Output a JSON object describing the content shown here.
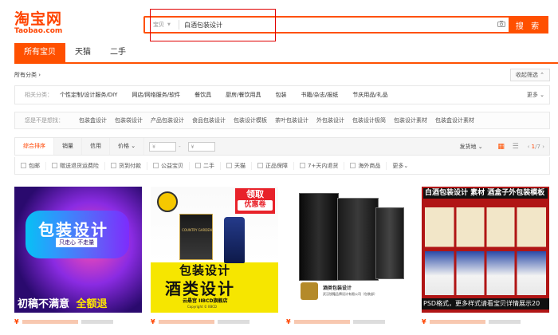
{
  "header": {
    "logo_cn": "淘宝网",
    "logo_en": "Taobao.com",
    "search_category": "宝贝",
    "search_value": "白酒包装设计",
    "search_button": "搜 索"
  },
  "tabs": [
    {
      "label": "所有宝贝",
      "active": true
    },
    {
      "label": "天猫",
      "active": false
    },
    {
      "label": "二手",
      "active": false
    }
  ],
  "crumb": {
    "all_categories": "所有分类",
    "fold": "收起筛选"
  },
  "related": {
    "label": "相关分类：",
    "items": [
      "个性定制/设计服务/DIY",
      "网店/网络服务/软件",
      "餐饮具",
      "厨房/餐饮用具",
      "包装",
      "书籍/杂志/报纸",
      "节庆用品/礼品"
    ],
    "more": "更多"
  },
  "want": {
    "label": "您是不是想找：",
    "items": [
      "包装盒设计",
      "包装袋设计",
      "产品包装设计",
      "食品包装设计",
      "包装设计模板",
      "茶叶包装设计",
      "外包装设计",
      "包装设计极简",
      "包装设计素材",
      "包装盒设计素材"
    ]
  },
  "sort": {
    "items": [
      "综合排序",
      "销量",
      "信用",
      "价格"
    ],
    "price_symbol": "¥",
    "ship_from": "发货地",
    "page_current": "1",
    "page_total": "/7"
  },
  "checks": {
    "items": [
      "包邮",
      "赠送退货运费险",
      "货到付款",
      "公益宝贝",
      "二手",
      "天猫",
      "正品保障",
      "7+天内退货",
      "海外商品"
    ],
    "more": "更多"
  },
  "products": [
    {
      "line1": "包装设计",
      "line2": "只走心 不走量",
      "line3": "初稿不满意",
      "line4": "全额退",
      "price": "¥"
    },
    {
      "badge1": "领取",
      "badge2": "优惠卷",
      "brand": "COUNTRY GARDEN",
      "line1": "包装设计",
      "line2": "酒类设计",
      "shop": "云悬宫 IIBCD旗舰店",
      "copyright": "Copyright © IIBCD",
      "price": "¥"
    },
    {
      "caption1": "酒类包装设计",
      "caption2": "武汉锐籍品牌设计有限公司（包装部）",
      "price": "¥"
    },
    {
      "title": "白酒包装设计 素材 酒盒子外包装模板",
      "foot": "PSD格式，更多样式请看宝贝详情展示20",
      "price": "¥"
    }
  ],
  "colors": {
    "accent": "#ff5000",
    "logo": "#ff4400"
  }
}
